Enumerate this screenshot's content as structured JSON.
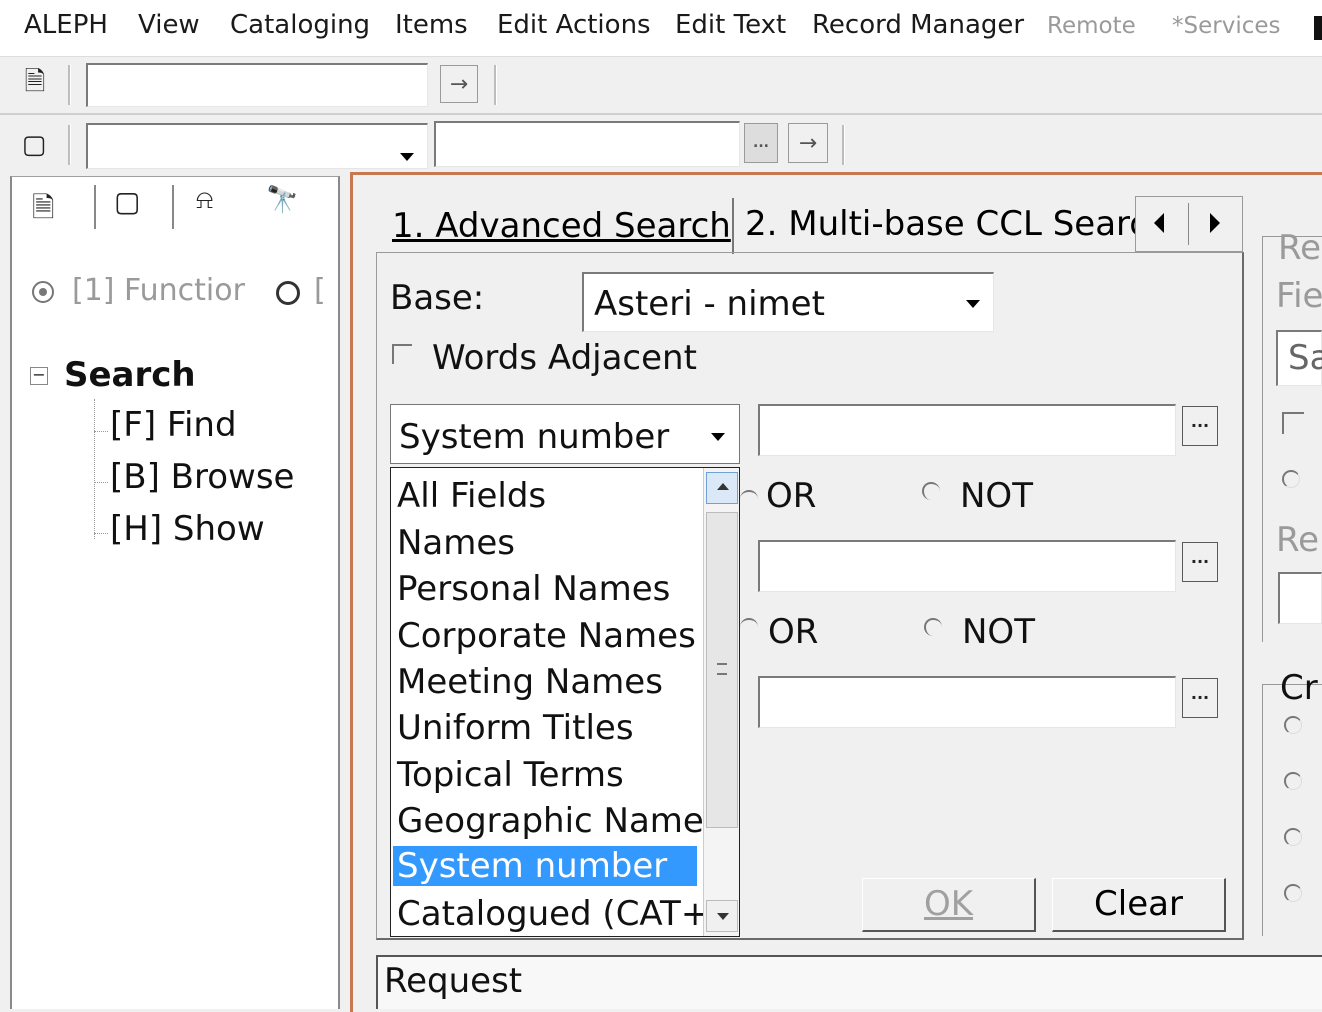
{
  "menubar": {
    "items": [
      "ALEPH",
      "View",
      "Cataloging",
      "Items",
      "Edit Actions",
      "Edit Text",
      "Record Manager"
    ],
    "disabled_items": [
      "Remote",
      "*Services"
    ]
  },
  "left_panel": {
    "radio1_label": "[1] Functior",
    "radio2_label": "[",
    "tree": {
      "root": "Search",
      "children": [
        "[F] Find",
        "[B] Browse",
        "[H] Show"
      ]
    }
  },
  "tabs": {
    "tab1": "1. Advanced Search",
    "tab2": "2. Multi-base CCL Searc"
  },
  "form": {
    "base_label": "Base:",
    "base_value": "Asteri - nimet",
    "words_adjacent": "Words Adjacent",
    "field_select_value": "System number",
    "or1": "OR",
    "not1": "NOT",
    "or2": "OR",
    "not2": "NOT",
    "dots": "...",
    "ok": "OK",
    "clear": "Clear"
  },
  "dropdown_list": {
    "items": [
      "All Fields",
      "Names",
      "Personal Names",
      "Corporate Names",
      "Meeting Names",
      "Uniform Titles",
      "Topical Terms",
      "Geographic Names",
      "System number",
      "Catalogued (CAT+"
    ],
    "selected": "System number"
  },
  "request_label": "Request",
  "right_strip": {
    "re": "Re",
    "fie": "Fie",
    "sa": "Sa",
    "re2": "Re",
    "cr": "Cr"
  }
}
